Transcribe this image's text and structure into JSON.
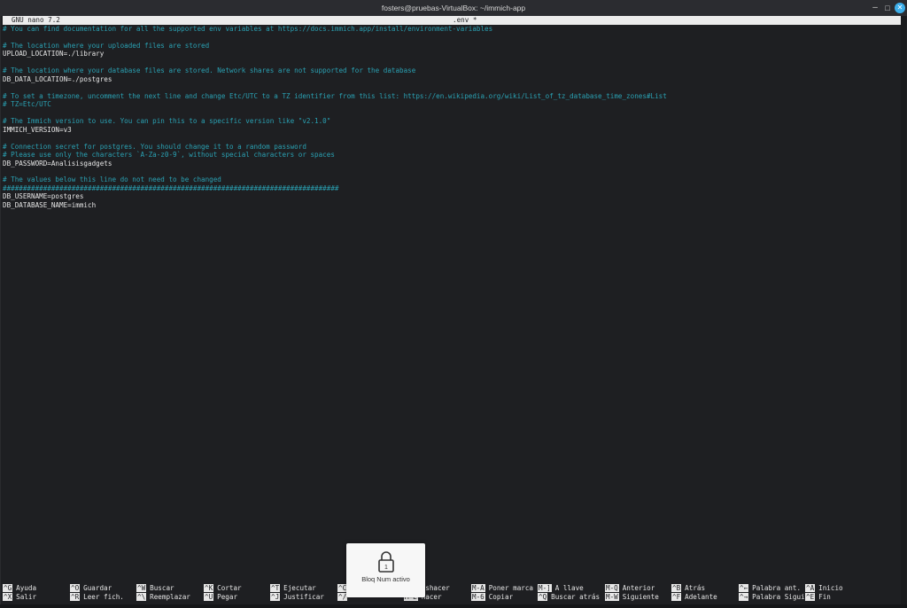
{
  "window": {
    "title": "fosters@pruebas-VirtualBox: ~/immich-app",
    "controls": {
      "minimize": "–",
      "maximize": "□",
      "close": "✕"
    }
  },
  "nano": {
    "version_label": "GNU nano 7.2",
    "filename": ".env *"
  },
  "buffer": {
    "lines": [
      {
        "text": "# You can find documentation for all the supported env variables at https://docs.immich.app/install/environment-variables",
        "comment": true
      },
      {
        "text": "",
        "comment": false
      },
      {
        "text": "# The location where your uploaded files are stored",
        "comment": true
      },
      {
        "text": "UPLOAD_LOCATION=./library",
        "comment": false
      },
      {
        "text": "",
        "comment": false
      },
      {
        "text": "# The location where your database files are stored. Network shares are not supported for the database",
        "comment": true
      },
      {
        "text": "DB_DATA_LOCATION=./postgres",
        "comment": false
      },
      {
        "text": "",
        "comment": false
      },
      {
        "text": "# To set a timezone, uncomment the next line and change Etc/UTC to a TZ identifier from this list: https://en.wikipedia.org/wiki/List_of_tz_database_time_zones#List",
        "comment": true
      },
      {
        "text": "# TZ=Etc/UTC",
        "comment": true
      },
      {
        "text": "",
        "comment": false
      },
      {
        "text": "# The Immich version to use. You can pin this to a specific version like \"v2.1.0\"",
        "comment": true
      },
      {
        "text": "IMMICH_VERSION=v3",
        "comment": false
      },
      {
        "text": "",
        "comment": false
      },
      {
        "text": "# Connection secret for postgres. You should change it to a random password",
        "comment": true
      },
      {
        "text": "# Please use only the characters `A-Za-z0-9`, without special characters or spaces",
        "comment": true
      },
      {
        "text": "DB_PASSWORD=Analisisgadgets",
        "comment": false
      },
      {
        "text": "",
        "comment": false
      },
      {
        "text": "# The values below this line do not need to be changed",
        "comment": true
      },
      {
        "text": "###################################################################################",
        "comment": true
      },
      {
        "text": "DB_USERNAME=postgres",
        "comment": false
      },
      {
        "text": "DB_DATABASE_NAME=immich",
        "comment": false
      }
    ]
  },
  "shortcuts": [
    {
      "key": "^G",
      "label": "Ayuda"
    },
    {
      "key": "^X",
      "label": "Salir"
    },
    {
      "key": "^O",
      "label": "Guardar"
    },
    {
      "key": "^R",
      "label": "Leer fich."
    },
    {
      "key": "^W",
      "label": "Buscar"
    },
    {
      "key": "^\\",
      "label": "Reemplazar"
    },
    {
      "key": "^K",
      "label": "Cortar"
    },
    {
      "key": "^U",
      "label": "Pegar"
    },
    {
      "key": "^T",
      "label": "Ejecutar"
    },
    {
      "key": "^J",
      "label": "Justificar"
    },
    {
      "key": "^C",
      "label": ""
    },
    {
      "key": "^/",
      "label": ""
    },
    {
      "key": "M-U",
      "label": "eshacer"
    },
    {
      "key": "M-E",
      "label": "hacer"
    },
    {
      "key": "M-A",
      "label": "Poner marca"
    },
    {
      "key": "M-6",
      "label": "Copiar"
    },
    {
      "key": "M-]",
      "label": "A llave"
    },
    {
      "key": "^Q",
      "label": "Buscar atrás"
    },
    {
      "key": "M-Q",
      "label": "Anterior"
    },
    {
      "key": "M-W",
      "label": "Siguiente"
    },
    {
      "key": "^B",
      "label": "Atrás"
    },
    {
      "key": "^F",
      "label": "Adelante"
    },
    {
      "key": "^←",
      "label": "Palabra ant."
    },
    {
      "key": "^→",
      "label": "Palabra Siguie"
    },
    {
      "key": "^A",
      "label": "Inicio"
    },
    {
      "key": "^E",
      "label": "Fin"
    }
  ],
  "osd": {
    "text": "Bloq Num activo",
    "badge": "1",
    "icon": "lock-icon"
  },
  "colors": {
    "background": "#1e1f22",
    "comment": "#2aa1b3",
    "text": "#e6e6e6",
    "header_bg": "#ececec",
    "close_button": "#3daee9"
  }
}
